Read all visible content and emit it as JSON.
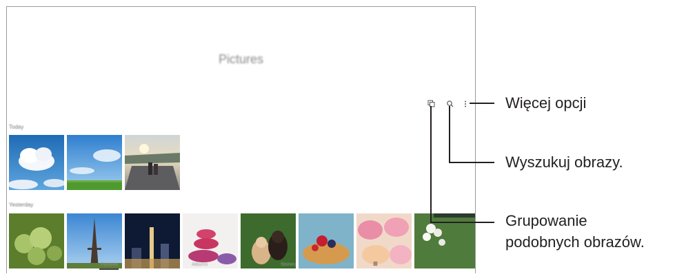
{
  "app": {
    "title": "Pictures",
    "section_1_label": "Today",
    "section_2_label": "Yesterday"
  },
  "toolbar": {
    "icons": [
      "group-similar-icon",
      "search-icon",
      "more-options-icon"
    ]
  },
  "bottom_nav": {
    "tabs": [
      "Pictures",
      "Albums",
      "Stories"
    ],
    "selected_tab": "Pictures",
    "menu_icon": "≡"
  },
  "annotations": {
    "more_options": "Więcej opcji",
    "search_images": "Wyszukuj obrazy.",
    "group_similar_line1": "Grupowanie",
    "group_similar_line2": "podobnych obrazów."
  },
  "colors": {
    "frame": "#9a9a9a",
    "callout": "#231f20"
  }
}
